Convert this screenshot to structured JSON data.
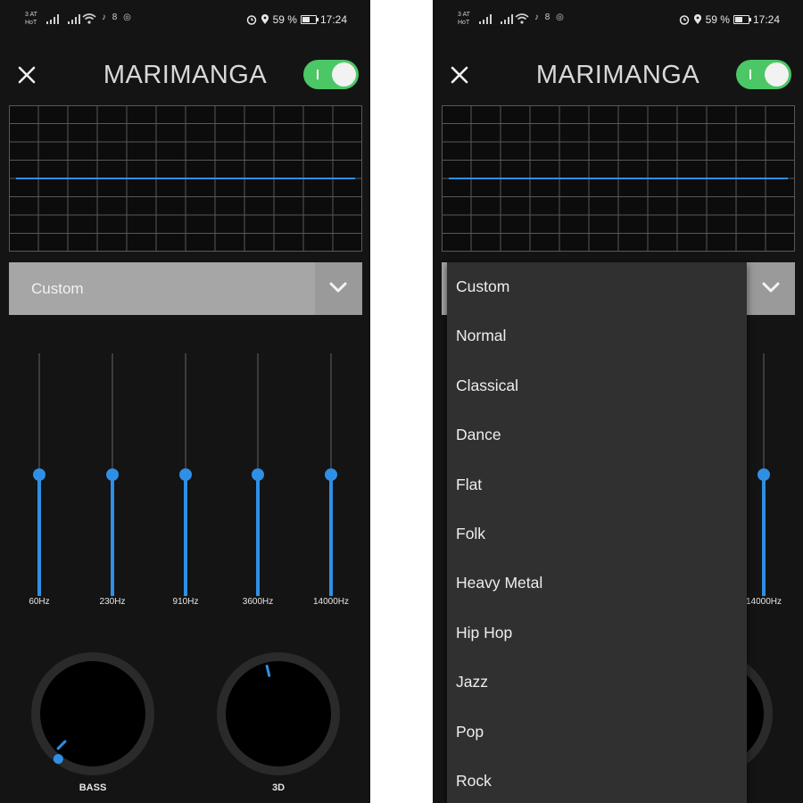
{
  "status_bar": {
    "carrier_line1": "3 AT",
    "carrier_line2": "HoT",
    "misc_icons": "♪ 8 ◎",
    "battery_percent": "59 %",
    "battery_level": 0.59,
    "time": "17:24"
  },
  "app": {
    "title": "MARIMANGA",
    "enabled": true
  },
  "colors": {
    "accent": "#2f8fe6",
    "toggle_on": "#4cc766",
    "background": "#141414",
    "dropdown": "#a6a6a6",
    "menu_bg": "#303030"
  },
  "preset": {
    "selected": "Custom",
    "options": [
      "Custom",
      "Normal",
      "Classical",
      "Dance",
      "Flat",
      "Folk",
      "Heavy Metal",
      "Hip Hop",
      "Jazz",
      "Pop",
      "Rock"
    ]
  },
  "bands": [
    {
      "label": "60Hz",
      "level": 0.5
    },
    {
      "label": "230Hz",
      "level": 0.5
    },
    {
      "label": "910Hz",
      "level": 0.5
    },
    {
      "label": "3600Hz",
      "level": 0.5
    },
    {
      "label": "14000Hz",
      "level": 0.5
    }
  ],
  "knobs": [
    {
      "label": "BASS",
      "level": 0.0
    },
    {
      "label": "3D",
      "level": 0.45
    }
  ],
  "icons": {
    "close": "close-icon",
    "dropdown": "chevron-down-icon",
    "wifi": "wifi-icon",
    "alarm": "alarm-icon",
    "location": "location-icon",
    "battery": "battery-icon"
  }
}
